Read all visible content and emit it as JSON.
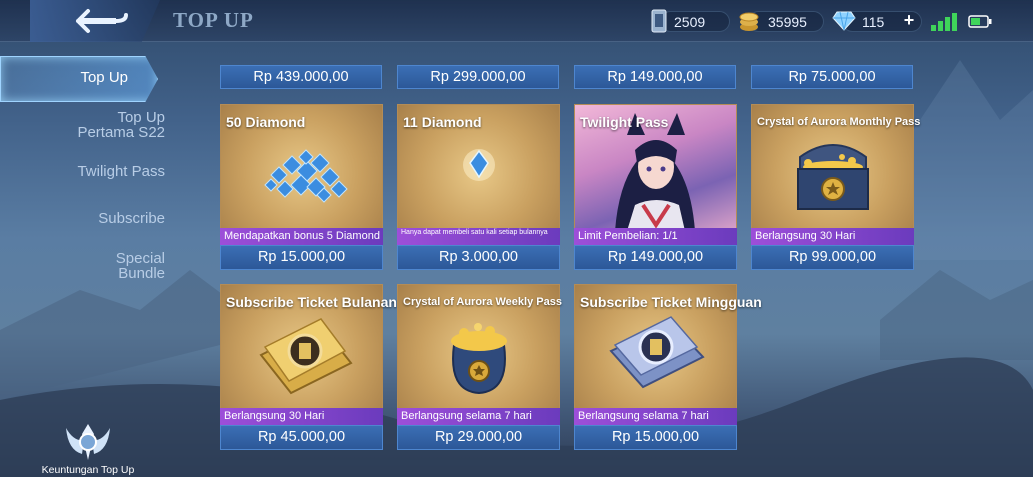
{
  "header": {
    "title": "TOP UP",
    "currencies": [
      {
        "name": "ticket",
        "icon": "ticket-card-icon",
        "value": "2509"
      },
      {
        "name": "battle-points",
        "icon": "coin-stack-icon",
        "value": "35995"
      },
      {
        "name": "diamonds",
        "icon": "diamond-icon",
        "value": "115"
      }
    ],
    "add_label": "+"
  },
  "sidebar": {
    "items": [
      {
        "label": "Top Up",
        "active": true
      },
      {
        "label": "Top Up\nPertama S22",
        "active": false
      },
      {
        "label": "Twilight Pass",
        "active": false
      },
      {
        "label": "Subscribe",
        "active": false
      },
      {
        "label": "Special\nBundle",
        "active": false
      }
    ],
    "footer_label": "Keuntungan Top Up"
  },
  "top_row_prices": [
    "Rp 439.000,00",
    "Rp 299.000,00",
    "Rp 149.000,00",
    "Rp 75.000,00"
  ],
  "cards": [
    {
      "name": "50 Diamond",
      "desc": "Mendapatkan bonus 5 Diamond",
      "price": "Rp 15.000,00",
      "art": "diamond-pile-icon"
    },
    {
      "name": "11 Diamond",
      "desc": "Hanya dapat membeli satu kali setiap bulannya",
      "price": "Rp 3.000,00",
      "art": "single-diamond-icon"
    },
    {
      "name": "Twilight Pass",
      "desc": "Limit Pembelian: 1/1",
      "price": "Rp 149.000,00",
      "art": "hero-portrait"
    },
    {
      "name": "Crystal of Aurora Monthly Pass",
      "desc": "Berlangsung 30 Hari",
      "price": "Rp 99.000,00",
      "art": "treasure-chest-icon"
    },
    {
      "name": "Subscribe Ticket Bulanan",
      "desc": "Berlangsung 30 Hari",
      "price": "Rp 45.000,00",
      "art": "gold-ticket-icon"
    },
    {
      "name": "Crystal of Aurora Weekly Pass",
      "desc": "Berlangsung selama 7 hari",
      "price": "Rp 29.000,00",
      "art": "gold-bag-icon"
    },
    {
      "name": "Subscribe Ticket Mingguan",
      "desc": "Berlangsung selama 7 hari",
      "price": "Rp 15.000,00",
      "art": "silver-ticket-icon"
    }
  ],
  "colors": {
    "price_bar": "#2c5898",
    "desc_bar": "#9d4fd9",
    "card_bg": "#c9a060",
    "title": "#8ea8c6"
  }
}
